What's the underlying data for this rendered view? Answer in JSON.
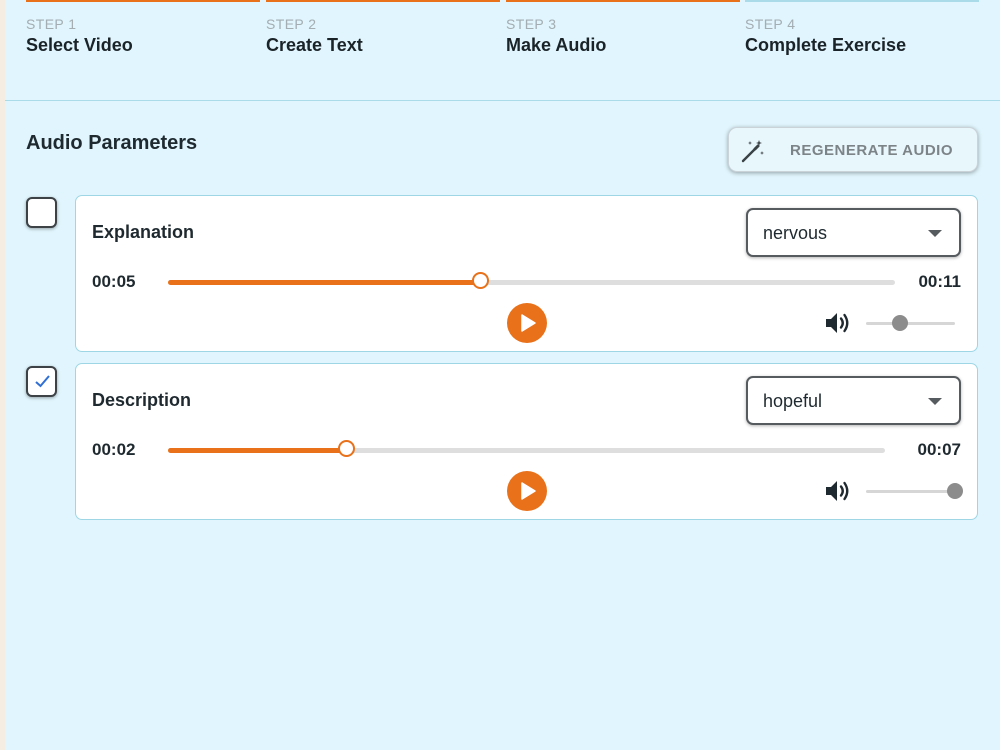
{
  "steps": [
    {
      "number": "STEP 1",
      "title": "Select Video",
      "bar_color": "#e8711a"
    },
    {
      "number": "STEP 2",
      "title": "Create Text",
      "bar_color": "#e8711a"
    },
    {
      "number": "STEP 3",
      "title": "Make Audio",
      "bar_color": "#e8711a"
    },
    {
      "number": "STEP 4",
      "title": "Complete Exercise",
      "bar_color": "#a9dbe8"
    }
  ],
  "section": {
    "title": "Audio Parameters"
  },
  "regenerate": {
    "label": "REGENERATE AUDIO",
    "icon": "magic-wand-icon"
  },
  "tracks": [
    {
      "selected": false,
      "title": "Explanation",
      "emotion": "nervous",
      "current_time": "00:05",
      "total_time": "00:11",
      "progress": 0.43,
      "volume": 0.38
    },
    {
      "selected": true,
      "title": "Description",
      "emotion": "hopeful",
      "current_time": "00:02",
      "total_time": "00:07",
      "progress": 0.25,
      "volume": 1.0
    }
  ],
  "colors": {
    "accent": "#e8711a",
    "background": "#e0f5fd",
    "card_border": "#9fd6e5",
    "check": "#2f6fd6"
  }
}
